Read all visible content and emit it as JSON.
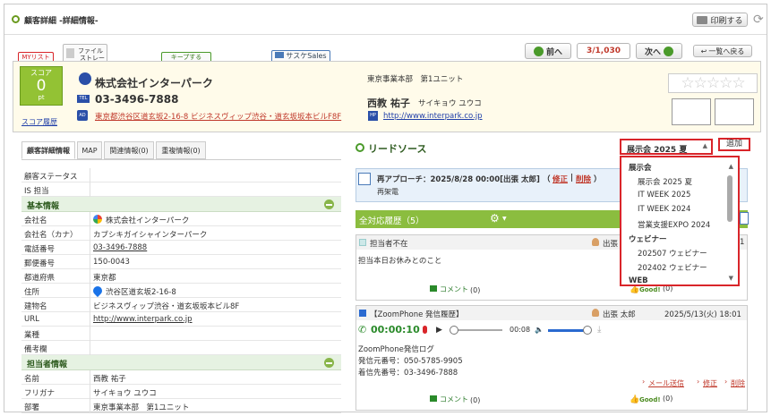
{
  "header": {
    "title": "顧客詳細 -詳細情報-",
    "print_label": "印刷する"
  },
  "tabs": {
    "mylist": "MYリスト",
    "file_storage_1": "ファイル",
    "file_storage_2": "ストレージ",
    "keep": "キープする",
    "sasuke": "サスケSales"
  },
  "nav": {
    "prev": "前へ",
    "counter": "3/1,030",
    "next": "次へ",
    "back_list": "一覧へ戻る"
  },
  "customer": {
    "score_label": "スコア",
    "score_value": "0",
    "score_unit": "pt",
    "score_history": "スコア履歴",
    "company": "株式会社インターパーク",
    "tel": "03-3496-7888",
    "address": "東京都渋谷区道玄坂2-16-8 ビジネスヴィップ渋谷・道玄坂坂本ビルF8F",
    "dept": "東京事業本部　第1ユニット",
    "contact_name": "西教 祐子",
    "contact_kana": "サイキョウ ユウコ",
    "website": "http://www.interpark.co.jp",
    "tel_badge": "TEL",
    "addr_badge": "AD",
    "hp_badge": "HP"
  },
  "left_tabs": [
    "顧客詳細情報",
    "MAP",
    "関連情報(0)",
    "重複情報(0)"
  ],
  "details": {
    "status_label": "顧客ステータス",
    "is_label": "IS 担当",
    "basic_section": "基本情報",
    "rows": [
      {
        "label": "会社名",
        "value": "株式会社インターパーク"
      },
      {
        "label": "会社名（カナ）",
        "value": "カブシキガイシャインターパーク"
      },
      {
        "label": "電話番号",
        "value": "03-3496-7888"
      },
      {
        "label": "郵便番号",
        "value": "150-0043"
      },
      {
        "label": "都道府県",
        "value": "東京都"
      },
      {
        "label": "住所",
        "value": "渋谷区道玄坂2-16-8"
      },
      {
        "label": "建物名",
        "value": "ビジネスヴィップ渋谷・道玄坂坂本ビル8F"
      },
      {
        "label": "URL",
        "value": "http://www.interpark.co.jp"
      },
      {
        "label": "業種",
        "value": ""
      },
      {
        "label": "備考欄",
        "value": ""
      }
    ],
    "contact_section": "担当者情報",
    "contact_rows": [
      {
        "label": "名前",
        "value": "西教 祐子"
      },
      {
        "label": "フリガナ",
        "value": "サイキョウ ユウコ"
      },
      {
        "label": "部署",
        "value": "東京事業本部　第1ユニット"
      }
    ]
  },
  "lead": {
    "title": "リードソース",
    "selected": "展示会 2025 夏",
    "add_label": "追加",
    "options": [
      {
        "type": "group",
        "label": "展示会"
      },
      {
        "type": "item",
        "label": "展示会 2025 夏"
      },
      {
        "type": "item",
        "label": "IT WEEK 2025"
      },
      {
        "type": "item",
        "label": "IT WEEK 2024"
      },
      {
        "type": "item",
        "label": "営業支援EXPO 2024"
      },
      {
        "type": "group",
        "label": "ウェビナー"
      },
      {
        "type": "item",
        "label": "202507 ウェビナー"
      },
      {
        "type": "item",
        "label": "202402 ウェビナー"
      },
      {
        "type": "group",
        "label": "WEB"
      }
    ]
  },
  "reapproach": {
    "text": "再アプローチ：2025/8/28 00:00[出張 太郎]",
    "edit": "修正",
    "delete": "削除",
    "sep": "|",
    "open_paren": "（",
    "close_paren": "）",
    "sub": "再架電"
  },
  "history": {
    "title": "全対応履歴（5）",
    "entry1": {
      "status": "担当者不在",
      "user": "出張",
      "body": "担当本日お休みとのこと",
      "comment": "コメント",
      "comment_count": "(0)",
      "good": "Good!",
      "good_count": "(0)",
      "suffix": "1"
    },
    "entry2": {
      "type": "【ZoomPhone 発信履歴】",
      "user": "出張 太郎",
      "datetime": "2025/5/13(火) 18:01",
      "elapsed": "00:00:10",
      "duration": "00:08",
      "log_title": "ZoomPhone発信ログ",
      "from": "発信元番号：050-5785-9905",
      "to": "着信先番号：03-3496-7888",
      "mail": "メール送信",
      "edit": "修正",
      "delete": "削除",
      "comment": "コメント",
      "comment_count": "(0)",
      "good": "Good!",
      "good_count": "(0)"
    }
  },
  "colors": {
    "accent_green": "#93c234",
    "link": "#1f3ea8",
    "alert_red": "#d9252a"
  }
}
